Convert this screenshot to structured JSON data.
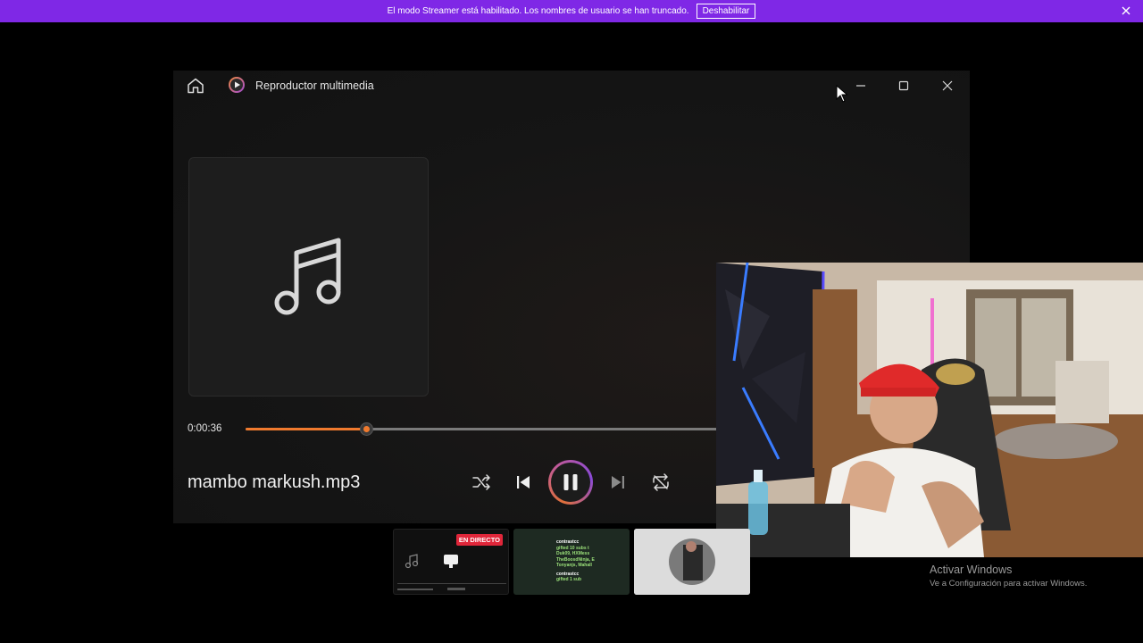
{
  "banner": {
    "text": "El modo Streamer está habilitado. Los nombres de usuario se han truncado.",
    "button_label": "Deshabilitar",
    "bg_color": "#7f28e6"
  },
  "player": {
    "title": "Reproductor multimedia",
    "time_current": "0:00:36",
    "progress_fraction": 0.25,
    "track_name": "mambo markush.mp3",
    "accent_color": "#f07a2e",
    "controls": [
      "shuffle-icon",
      "previous-icon",
      "pause-icon",
      "next-icon",
      "repeat-icon"
    ]
  },
  "thumbnails": {
    "live_badge": "EN DIRECTO",
    "chat": {
      "user1": "contrastcc",
      "line1": "gifted 10 subs t",
      "line2": "Duk09, HXMess",
      "line3": "TheBoosdNinja, E",
      "line4": "Tonyanjs, Mahall",
      "user2": "contrastcc",
      "line5": "gifted 1 sub"
    }
  },
  "activate_windows": {
    "title": "Activar Windows",
    "subtitle": "Ve a Configuración para activar Windows."
  }
}
